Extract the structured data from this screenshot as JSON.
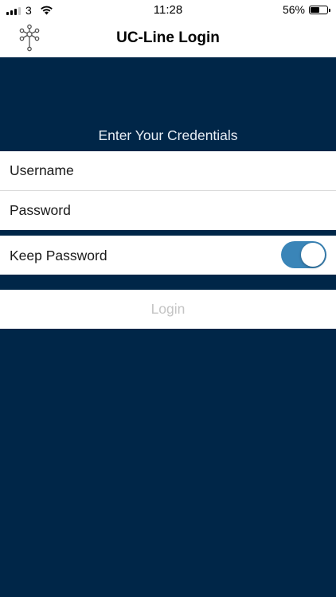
{
  "status_bar": {
    "carrier": "3",
    "time": "11:28",
    "battery_percent_label": "56%",
    "battery_level": 0.56,
    "signal_bars_active": 3,
    "signal_bars_total": 4
  },
  "nav": {
    "title": "UC-Line Login",
    "logo_icon": "network-nodes-icon"
  },
  "form": {
    "section_header": "Enter Your Credentials",
    "username_placeholder": "Username",
    "username_value": "",
    "password_placeholder": "Password",
    "password_value": "",
    "keep_password_label": "Keep Password",
    "keep_password_on": true,
    "login_label": "Login",
    "login_enabled": false
  },
  "colors": {
    "background": "#002648",
    "toggle_on": "#3a85b8",
    "login_disabled_text": "#c4c4c4"
  }
}
